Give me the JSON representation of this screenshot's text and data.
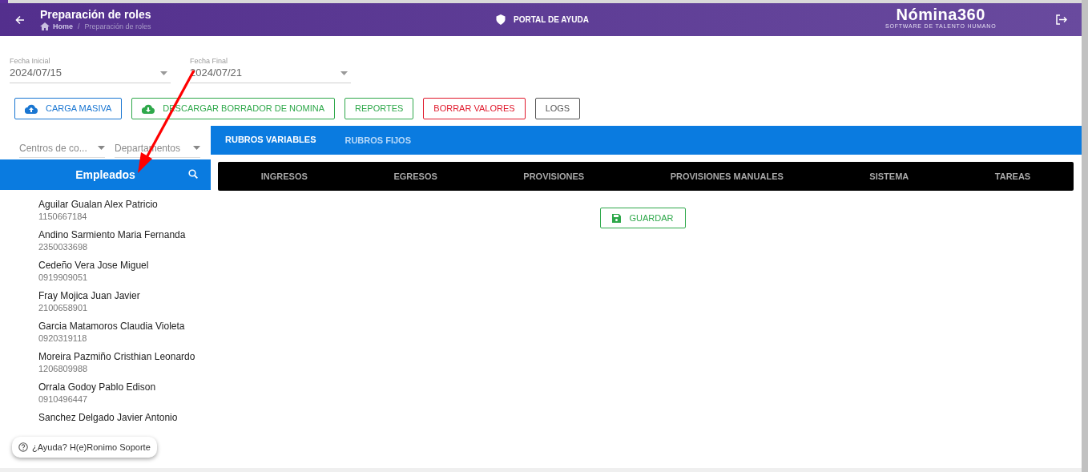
{
  "header": {
    "title": "Preparación de roles",
    "breadcrumb": [
      "Home",
      "/",
      "Preparación de roles"
    ],
    "help_link": "PORTAL DE AYUDA",
    "logo": {
      "name": "Nómina360",
      "tagline": "SOFTWARE DE TALENTO HUMANO"
    }
  },
  "date_fields": [
    {
      "label": "Fecha Inicial",
      "value": "2024/07/15"
    },
    {
      "label": "Fecha Final",
      "value": "2024/07/21"
    }
  ],
  "actions": [
    {
      "label": "CARGA MASIVA",
      "kind": "upload",
      "color": "#1976d2"
    },
    {
      "label": "DESCARGAR BORRADOR DE NOMINA",
      "kind": "download",
      "color": "#2ea84a"
    },
    {
      "label": "REPORTES",
      "kind": "plain",
      "color": "#2ea84a"
    },
    {
      "label": "BORRAR VALORES",
      "kind": "plain",
      "color": "#e0182b"
    },
    {
      "label": "LOGS",
      "kind": "plain",
      "color": "#555555"
    }
  ],
  "filters": [
    {
      "placeholder": "Centros de co..."
    },
    {
      "placeholder": "Departamentos"
    }
  ],
  "employees": {
    "title": "Empleados",
    "items": [
      {
        "name": "Aguilar Gualan Alex Patricio",
        "id": "1150667184"
      },
      {
        "name": "Andino Sarmiento Maria Fernanda",
        "id": "2350033698"
      },
      {
        "name": "Cedeño Vera Jose Miguel",
        "id": "0919909051"
      },
      {
        "name": "Fray Mojica Juan Javier",
        "id": "2100658901"
      },
      {
        "name": "Garcia Matamoros Claudia Violeta",
        "id": "0920319118"
      },
      {
        "name": "Moreira Pazmiño Cristhian Leonardo",
        "id": "1206809988"
      },
      {
        "name": "Orrala Godoy Pablo Edison",
        "id": "0910496447"
      },
      {
        "name": "Sanchez Delgado Javier Antonio"
      }
    ]
  },
  "tabs": [
    {
      "label": "RUBROS VARIABLES",
      "selected": true
    },
    {
      "label": "RUBROS FIJOS",
      "selected": false
    }
  ],
  "subtabs": [
    "INGRESOS",
    "EGRESOS",
    "PROVISIONES",
    "PROVISIONES MANUALES",
    "SISTEMA",
    "TAREAS"
  ],
  "save_button": "GUARDAR",
  "help_chip": "¿Ayuda? H(e)Ronimo Soporte"
}
